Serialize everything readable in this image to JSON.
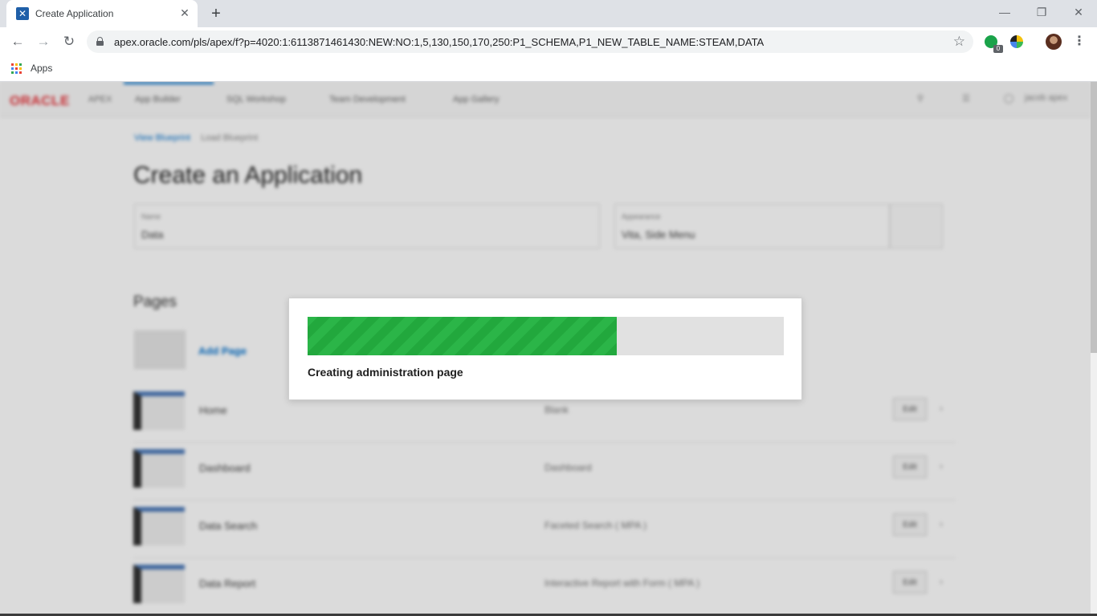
{
  "browser": {
    "tab_title": "Create Application",
    "url": "apex.oracle.com/pls/apex/f?p=4020:1:6113871461430:NEW:NO:1,5,130,150,170,250:P1_SCHEMA,P1_NEW_TABLE_NAME:STEAM,DATA",
    "extension_badge": "0",
    "bookmarks": {
      "apps_label": "Apps"
    },
    "icons": [
      "back-icon",
      "forward-icon",
      "reload-icon",
      "lock-icon",
      "star-icon",
      "apps-icon",
      "menu-icon"
    ]
  },
  "apex": {
    "logo": "ORACLE",
    "logo_suffix": "APEX",
    "nav": [
      "App Builder",
      "SQL Workshop",
      "Team Development",
      "App Gallery"
    ],
    "user": "jacob apex",
    "breadcrumb": {
      "parent": "View Blueprint",
      "current": "Load Blueprint"
    },
    "title": "Create an Application",
    "name_field": {
      "label": "Name",
      "value": "Data"
    },
    "appearance_field": {
      "label": "Appearance",
      "value": "Vita, Side Menu"
    },
    "pages_section": "Pages",
    "add_page": "Add Page",
    "edit_label": "Edit",
    "pages": [
      {
        "name": "Home",
        "type": "Blank"
      },
      {
        "name": "Dashboard",
        "type": "Dashboard"
      },
      {
        "name": "Data Search",
        "type": "Faceted Search ( MPA )"
      },
      {
        "name": "Data Report",
        "type": "Interactive Report with Form ( MPA )"
      }
    ]
  },
  "dialog": {
    "progress_fraction": 0.65,
    "message": "Creating administration page",
    "fill_color": "#22a83d"
  }
}
